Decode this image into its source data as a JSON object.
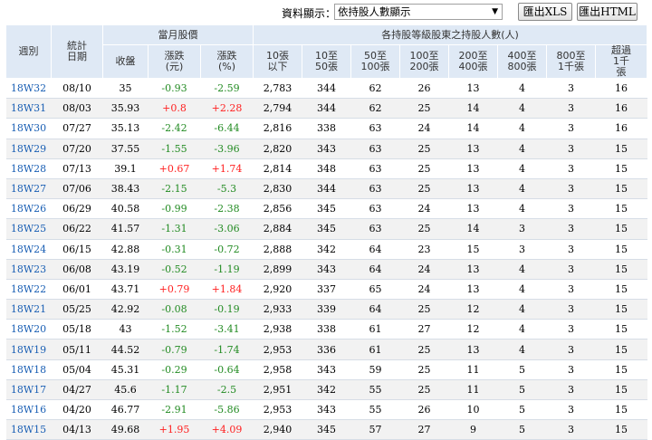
{
  "toolbar": {
    "display_label": "資料顯示：",
    "display_value": "依持股人數顯示",
    "export_xls": "匯出XLS",
    "export_html": "匯出HTML"
  },
  "headers": {
    "week": "週別",
    "date": "統計日期",
    "price_group": "當月股價",
    "close": "收盤",
    "change": "漲跌(元)",
    "change_pct": "漲跌(%)",
    "holders_group": "各持股等級股東之持股人數(人)",
    "tiers": [
      "10張以下",
      "10至50張",
      "50至100張",
      "100至200張",
      "200至400張",
      "400至800張",
      "800至1千張",
      "超過1千張"
    ]
  },
  "rows": [
    {
      "week": "18W32",
      "date": "08/10",
      "close": "35",
      "chg": "-0.93",
      "pct": "-2.59",
      "t": [
        "2,783",
        "344",
        "62",
        "26",
        "13",
        "4",
        "3",
        "16"
      ]
    },
    {
      "week": "18W31",
      "date": "08/03",
      "close": "35.93",
      "chg": "+0.8",
      "pct": "+2.28",
      "t": [
        "2,794",
        "344",
        "62",
        "25",
        "14",
        "4",
        "3",
        "16"
      ]
    },
    {
      "week": "18W30",
      "date": "07/27",
      "close": "35.13",
      "chg": "-2.42",
      "pct": "-6.44",
      "t": [
        "2,816",
        "338",
        "63",
        "24",
        "14",
        "4",
        "3",
        "16"
      ]
    },
    {
      "week": "18W29",
      "date": "07/20",
      "close": "37.55",
      "chg": "-1.55",
      "pct": "-3.96",
      "t": [
        "2,820",
        "343",
        "63",
        "25",
        "13",
        "4",
        "3",
        "15"
      ]
    },
    {
      "week": "18W28",
      "date": "07/13",
      "close": "39.1",
      "chg": "+0.67",
      "pct": "+1.74",
      "t": [
        "2,814",
        "348",
        "63",
        "25",
        "13",
        "4",
        "3",
        "15"
      ]
    },
    {
      "week": "18W27",
      "date": "07/06",
      "close": "38.43",
      "chg": "-2.15",
      "pct": "-5.3",
      "t": [
        "2,830",
        "344",
        "63",
        "25",
        "13",
        "4",
        "3",
        "15"
      ]
    },
    {
      "week": "18W26",
      "date": "06/29",
      "close": "40.58",
      "chg": "-0.99",
      "pct": "-2.38",
      "t": [
        "2,856",
        "345",
        "63",
        "24",
        "13",
        "4",
        "3",
        "15"
      ]
    },
    {
      "week": "18W25",
      "date": "06/22",
      "close": "41.57",
      "chg": "-1.31",
      "pct": "-3.06",
      "t": [
        "2,884",
        "345",
        "63",
        "25",
        "14",
        "3",
        "3",
        "15"
      ]
    },
    {
      "week": "18W24",
      "date": "06/15",
      "close": "42.88",
      "chg": "-0.31",
      "pct": "-0.72",
      "t": [
        "2,888",
        "342",
        "64",
        "23",
        "15",
        "3",
        "3",
        "15"
      ]
    },
    {
      "week": "18W23",
      "date": "06/08",
      "close": "43.19",
      "chg": "-0.52",
      "pct": "-1.19",
      "t": [
        "2,899",
        "343",
        "64",
        "24",
        "13",
        "4",
        "3",
        "15"
      ]
    },
    {
      "week": "18W22",
      "date": "06/01",
      "close": "43.71",
      "chg": "+0.79",
      "pct": "+1.84",
      "t": [
        "2,920",
        "337",
        "65",
        "24",
        "13",
        "4",
        "3",
        "15"
      ]
    },
    {
      "week": "18W21",
      "date": "05/25",
      "close": "42.92",
      "chg": "-0.08",
      "pct": "-0.19",
      "t": [
        "2,933",
        "339",
        "64",
        "25",
        "12",
        "4",
        "3",
        "15"
      ]
    },
    {
      "week": "18W20",
      "date": "05/18",
      "close": "43",
      "chg": "-1.52",
      "pct": "-3.41",
      "t": [
        "2,938",
        "338",
        "61",
        "27",
        "12",
        "4",
        "3",
        "15"
      ]
    },
    {
      "week": "18W19",
      "date": "05/11",
      "close": "44.52",
      "chg": "-0.79",
      "pct": "-1.74",
      "t": [
        "2,953",
        "336",
        "61",
        "25",
        "13",
        "4",
        "3",
        "15"
      ]
    },
    {
      "week": "18W18",
      "date": "05/04",
      "close": "45.31",
      "chg": "-0.29",
      "pct": "-0.64",
      "t": [
        "2,958",
        "343",
        "59",
        "25",
        "11",
        "5",
        "3",
        "15"
      ]
    },
    {
      "week": "18W17",
      "date": "04/27",
      "close": "45.6",
      "chg": "-1.17",
      "pct": "-2.5",
      "t": [
        "2,951",
        "342",
        "55",
        "25",
        "11",
        "5",
        "3",
        "15"
      ]
    },
    {
      "week": "18W16",
      "date": "04/20",
      "close": "46.77",
      "chg": "-2.91",
      "pct": "-5.86",
      "t": [
        "2,953",
        "343",
        "55",
        "26",
        "10",
        "5",
        "3",
        "15"
      ]
    },
    {
      "week": "18W15",
      "date": "04/13",
      "close": "49.68",
      "chg": "+1.95",
      "pct": "+4.09",
      "t": [
        "2,940",
        "345",
        "57",
        "27",
        "9",
        "5",
        "3",
        "15"
      ]
    }
  ],
  "colors": {
    "up": "#ff2020",
    "down": "#228b22",
    "link": "#1a5fb4",
    "header_bg": "#dfe9f5"
  }
}
